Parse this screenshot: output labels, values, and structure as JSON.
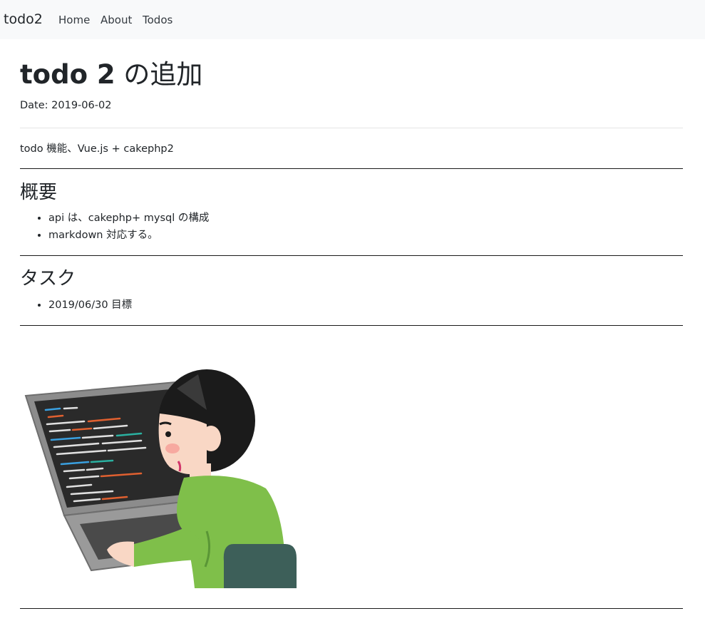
{
  "navbar": {
    "brand": "todo2",
    "links": [
      {
        "label": "Home"
      },
      {
        "label": "About"
      },
      {
        "label": "Todos"
      }
    ]
  },
  "article": {
    "title_bold": "todo 2",
    "title_rest": " の追加",
    "date": "Date: 2019-06-02",
    "summary": "todo 機能、Vue.js + cakephp2",
    "sections": [
      {
        "heading": "概要",
        "items": [
          "api は、cakephp+ mysql の構成",
          "markdown 対応する。"
        ]
      },
      {
        "heading": "タスク",
        "items": [
          "2019/06/30 目標"
        ]
      }
    ],
    "image": {
      "icon": "programmer-at-laptop-illustration"
    }
  },
  "colors": {
    "navbar_bg": "#f8f9fa",
    "text": "#212529",
    "shirt": "#7fbf4a",
    "chair": "#3d5f59",
    "screen": "#2a2a2a"
  }
}
